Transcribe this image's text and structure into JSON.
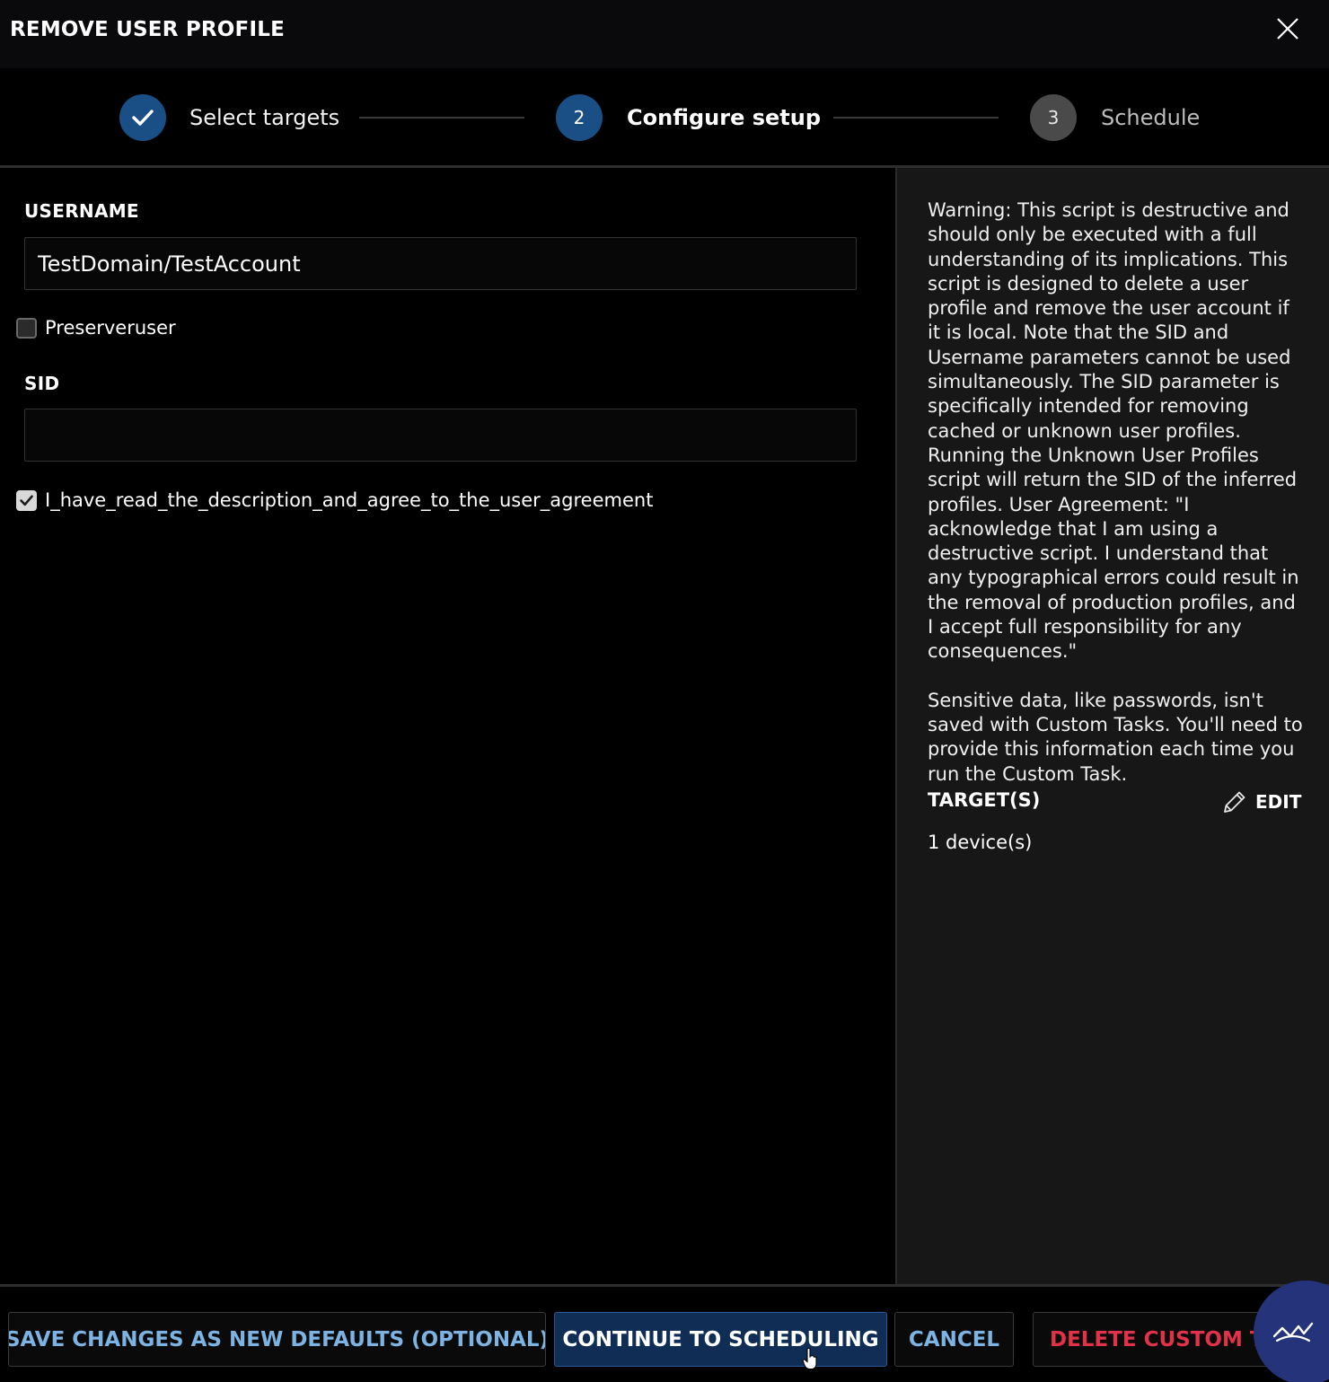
{
  "dialog": {
    "title": "REMOVE USER PROFILE",
    "close_icon": "close-icon"
  },
  "stepper": {
    "steps": [
      {
        "number": "",
        "label": "Select targets",
        "state": "completed",
        "icon": "check-icon"
      },
      {
        "number": "2",
        "label": "Configure setup",
        "state": "active"
      },
      {
        "number": "3",
        "label": "Schedule",
        "state": "pending"
      }
    ]
  },
  "form": {
    "username": {
      "label": "USERNAME",
      "value": "TestDomain/TestAccount",
      "placeholder": ""
    },
    "preserveruser": {
      "label": "Preserveruser",
      "checked": false
    },
    "sid": {
      "label": "SID",
      "value": "",
      "placeholder": ""
    },
    "agreement": {
      "label": "I_have_read_the_description_and_agree_to_the_user_agreement",
      "checked": true
    }
  },
  "info": {
    "description": "Warning: This script is destructive and should only be executed with a full understanding of its implications. This script is designed to delete a user profile and remove the user account if it is local. Note that the SID and Username parameters cannot be used simultaneously. The SID parameter is specifically intended for removing cached or unknown user profiles. Running the Unknown User Profiles script will return the SID of the inferred profiles. User Agreement: \"I acknowledge that I am using a destructive script. I understand that any typographical errors could result in the removal of production profiles, and I accept full responsibility for any consequences.\"",
    "sensitive_note": "Sensitive data, like passwords, isn't saved with Custom Tasks. You'll need to provide this information each time you run the Custom Task.",
    "targets_heading": "TARGET(S)",
    "edit_label": "EDIT",
    "edit_icon": "pencil-icon",
    "targets_value": "1 device(s)"
  },
  "footer": {
    "save_defaults_label": "SAVE CHANGES AS NEW DEFAULTS (OPTIONAL)",
    "continue_label": "CONTINUE TO SCHEDULING",
    "cancel_label": "CANCEL",
    "delete_label": "DELETE CUSTOM TA"
  },
  "colors": {
    "accent_blue": "#1a4f86",
    "primary_button": "#0f2d55",
    "link_blue": "#7db3e3",
    "danger_red": "#e0334a",
    "chat_fab": "#24337a"
  }
}
